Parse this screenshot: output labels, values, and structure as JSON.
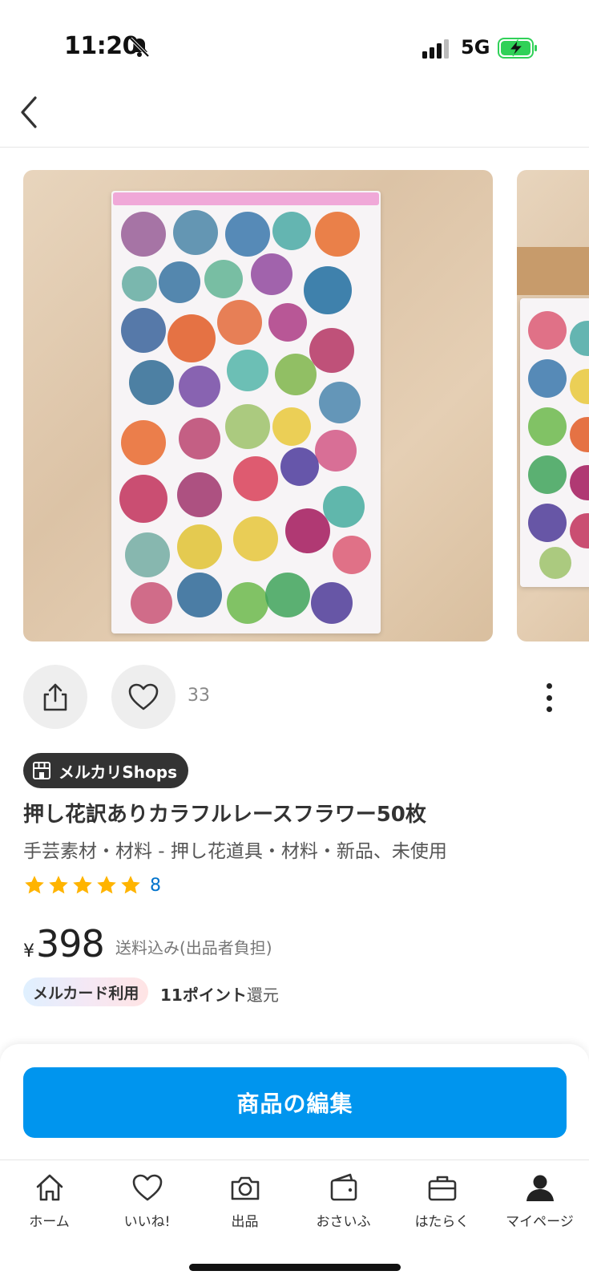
{
  "status_bar": {
    "time": "11:20",
    "network": "5G"
  },
  "product": {
    "like_count": "33",
    "shop_badge": "メルカリShops",
    "title": "押し花訳ありカラフルレースフラワー50枚",
    "category": "手芸素材・材料 - 押し花道具・材料・新品、未使用",
    "rating_stars": 5,
    "rating_count": "8",
    "currency": "¥",
    "price": "398",
    "shipping": "送料込み(出品者負担)",
    "card_badge": "メルカード利用",
    "points_amount": "11ポイント",
    "points_suffix": "還元"
  },
  "actions": {
    "edit_button": "商品の編集"
  },
  "tabs": [
    {
      "label": "ホーム",
      "icon": "home-icon"
    },
    {
      "label": "いいね!",
      "icon": "heart-icon"
    },
    {
      "label": "出品",
      "icon": "camera-icon"
    },
    {
      "label": "おさいふ",
      "icon": "wallet-icon"
    },
    {
      "label": "はたらく",
      "icon": "briefcase-icon"
    },
    {
      "label": "マイページ",
      "icon": "person-icon"
    }
  ],
  "colors": {
    "primary_button": "#0095ee",
    "star": "#ffb400",
    "link": "#0073cc"
  }
}
